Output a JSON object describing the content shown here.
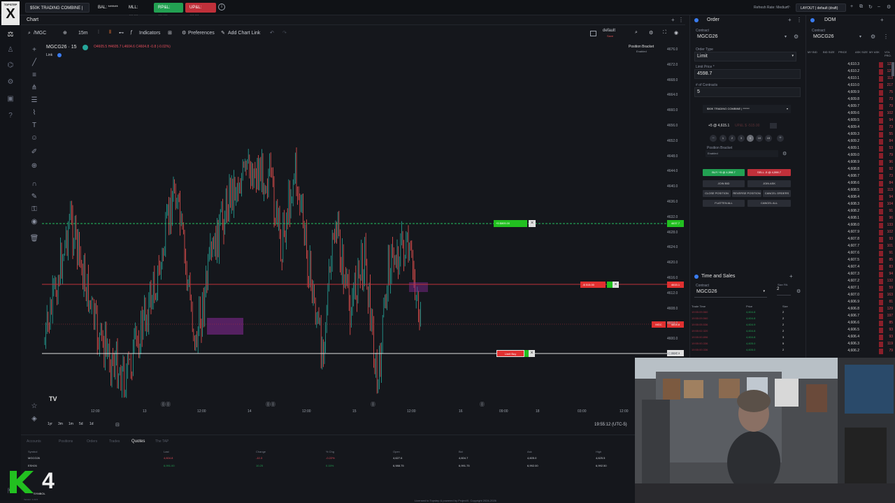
{
  "topbar": {
    "logo_small": "TOPSTEP",
    "logo_big": "X",
    "account_selector": "$50K TRADING COMBINE | *...",
    "bal": "BAL: ******",
    "mll": "MLL: ******",
    "rpnl": "RP&L: ******",
    "upnl": "UP&L: ******",
    "refresh_rate": "Refresh Rate: Medium",
    "layout": "LAYOUT | default (draft)"
  },
  "chart": {
    "panel_title": "Chart",
    "symbol_input": "/MGC",
    "interval": "15m",
    "indicators_label": "Indicators",
    "preferences_label": "Preferences",
    "add_chart_link_label": "Add Chart Link",
    "save_template": "default",
    "save_sub": "Save",
    "legend_symbol": "MGCG26 · 15",
    "legend_ohlc": "O4605.5  H4605.7  L4604.6  C4604.8  -0.8 (-0.02%)",
    "link_label": "Link",
    "position_bracket": "Position Bracket",
    "position_bracket_sub": "Enabled",
    "price_ticks": [
      "4676.0",
      "4672.0",
      "4668.0",
      "4664.0",
      "4660.0",
      "4656.0",
      "4652.0",
      "4648.0",
      "4644.0",
      "4640.0",
      "4636.0",
      "4632.0",
      "4628.0",
      "4624.0",
      "4620.0",
      "4616.0",
      "4612.0",
      "4608.0",
      "4604.0",
      "4600.0",
      "4596.0"
    ],
    "time_ticks": [
      "12:00",
      "13",
      "12:00",
      "14",
      "12:00",
      "15",
      "12:00",
      "16",
      "09:00",
      "18",
      "03:00",
      "12:00"
    ],
    "timestamp": "19:55:12 (UTC-5)",
    "ranges": [
      "1yr",
      "3m",
      "1m",
      "5d",
      "1d"
    ],
    "tp_order_label": "+5  $805.00",
    "tp_price": "4637.7",
    "position_label": "-$ 515.00",
    "position_price": "4615.1",
    "last_label": "MGC",
    "last_price": "4604.8",
    "limit_label": "Limit Buy",
    "limit_price": "4597.3",
    "watermark": "TV"
  },
  "order": {
    "panel_title": "Order",
    "contract_label": "Contract",
    "contract": "MGCG26",
    "order_type_label": "Order Type",
    "order_type": "Limit",
    "limit_price_label": "Limit Price *",
    "limit_price": "4598.7",
    "contracts_label": "# of Contracts",
    "contracts": "5",
    "account": "$50K TRADING COMBINE | ******",
    "position": "+5 @ 4,615.1",
    "upnl": "UP&L $ -515.00",
    "qty_buttons": [
      "1",
      "2",
      "3",
      "5",
      "10",
      "15"
    ],
    "bracket_label": "Position Bracket",
    "bracket_value": "Enabled",
    "buy_button": "BUY +5 @ 4,598.7",
    "sell_button": "SELL -5 @ 4,598.7",
    "join_bid": "JOIN BID",
    "join_ask": "JOIN ASK",
    "close_position": "CLOSE POSITION",
    "reverse_position": "REVERSE POSITION",
    "cancel_orders": "CANCEL ORDERS",
    "flatten_all": "FLATTEN ALL",
    "cancel_all": "CANCEL ALL"
  },
  "time_and_sales": {
    "panel_title": "Time and Sales",
    "contract_label": "Contract",
    "contract": "MGCG26",
    "size_filter_label": "Size Filt.",
    "size_filter": "2",
    "columns": [
      "Trade Time",
      "Price",
      "Size"
    ],
    "rows": [
      {
        "time": "19:55:09.560",
        "price": "4,604.8",
        "size": "2"
      },
      {
        "time": "19:55:09.560",
        "price": "4,604.8",
        "size": "2"
      },
      {
        "time": "19:55:05.536",
        "price": "4,604.9",
        "size": "2"
      },
      {
        "time": "19:55:02.320",
        "price": "4,604.8",
        "size": "2"
      },
      {
        "time": "19:55:00.896",
        "price": "4,604.8",
        "size": "3"
      },
      {
        "time": "19:55:00.336",
        "price": "4,605.0",
        "size": "5"
      },
      {
        "time": "19:55:00.336",
        "price": "4,605.0",
        "size": "2"
      }
    ]
  },
  "dom": {
    "panel_title": "DOM",
    "contract_label": "Contract",
    "contract": "MGCG26",
    "columns": [
      "MY BID",
      "BID SIZE",
      "PRICE",
      "ASK SIZE",
      "MY ASK",
      "VOL PRO."
    ],
    "rows": [
      {
        "price": "4,610.3",
        "size": "122"
      },
      {
        "price": "4,610.2",
        "size": "127"
      },
      {
        "price": "4,610.1",
        "size": "113"
      },
      {
        "price": "4,610.0",
        "size": "217"
      },
      {
        "price": "4,609.9",
        "size": "75"
      },
      {
        "price": "4,609.8",
        "size": "73"
      },
      {
        "price": "4,609.7",
        "size": "79"
      },
      {
        "price": "4,609.6",
        "size": "102"
      },
      {
        "price": "4,609.5",
        "size": "94"
      },
      {
        "price": "4,609.4",
        "size": "73"
      },
      {
        "price": "4,609.3",
        "size": "55"
      },
      {
        "price": "4,609.2",
        "size": "84"
      },
      {
        "price": "4,609.1",
        "size": "53"
      },
      {
        "price": "4,609.0",
        "size": "79"
      },
      {
        "price": "4,608.9",
        "size": "96"
      },
      {
        "price": "4,608.8",
        "size": "92"
      },
      {
        "price": "4,608.7",
        "size": "73"
      },
      {
        "price": "4,608.6",
        "size": "84"
      },
      {
        "price": "4,608.5",
        "size": "113"
      },
      {
        "price": "4,608.4",
        "size": "94"
      },
      {
        "price": "4,608.3",
        "size": "104"
      },
      {
        "price": "4,608.2",
        "size": "91"
      },
      {
        "price": "4,608.1",
        "size": "96"
      },
      {
        "price": "4,608.0",
        "size": "133"
      },
      {
        "price": "4,607.9",
        "size": "102"
      },
      {
        "price": "4,607.8",
        "size": "93"
      },
      {
        "price": "4,607.7",
        "size": "101"
      },
      {
        "price": "4,607.6",
        "size": "91"
      },
      {
        "price": "4,607.5",
        "size": "85"
      },
      {
        "price": "4,607.4",
        "size": "83"
      },
      {
        "price": "4,607.3",
        "size": "94"
      },
      {
        "price": "4,607.2",
        "size": "132"
      },
      {
        "price": "4,607.1",
        "size": "59"
      },
      {
        "price": "4,607.0",
        "size": "163"
      },
      {
        "price": "4,606.9",
        "size": "81"
      },
      {
        "price": "4,606.8",
        "size": "129"
      },
      {
        "price": "4,606.7",
        "size": "197"
      },
      {
        "price": "4,606.6",
        "size": "85"
      },
      {
        "price": "4,606.5",
        "size": "93"
      },
      {
        "price": "4,606.4",
        "size": "93"
      },
      {
        "price": "4,606.3",
        "size": "119"
      },
      {
        "price": "4,606.2",
        "size": "79"
      }
    ]
  },
  "quotes": {
    "tabs": [
      "Accounts",
      "Positions",
      "Orders",
      "Trades",
      "Quotes",
      "The TAP"
    ],
    "active_tab": "Quotes",
    "columns": [
      "Symbol",
      "Last",
      "Change",
      "% Chg",
      "Open",
      "Bid",
      "Ask",
      "High"
    ],
    "rows": [
      {
        "symbol": "MGCG26",
        "last": "4,604.8",
        "change": "-10.3",
        "pct": "-0.22%",
        "open": "4,627.6",
        "bid": "4,604.7",
        "ask": "4,605.0",
        "high": "4,625.5"
      },
      {
        "symbol": "ESH26",
        "last": "6,991.00",
        "change": "10.25",
        "pct": "0.15%",
        "open": "6,988.75",
        "bid": "6,991.75",
        "ask": "6,992.00",
        "high": "6,992.50"
      }
    ],
    "footer": "Licensed to Topstep & powered by ProjectX. Copyright 2024-2026",
    "version": "Version: 1.22.0"
  },
  "overlay": {
    "k4": "4",
    "k4_sub": "SYMBOL"
  },
  "colors": {
    "bg": "#15171c",
    "up": "#26a69a",
    "down": "#ef5350",
    "buy": "#22a052",
    "sell": "#c0303a"
  }
}
